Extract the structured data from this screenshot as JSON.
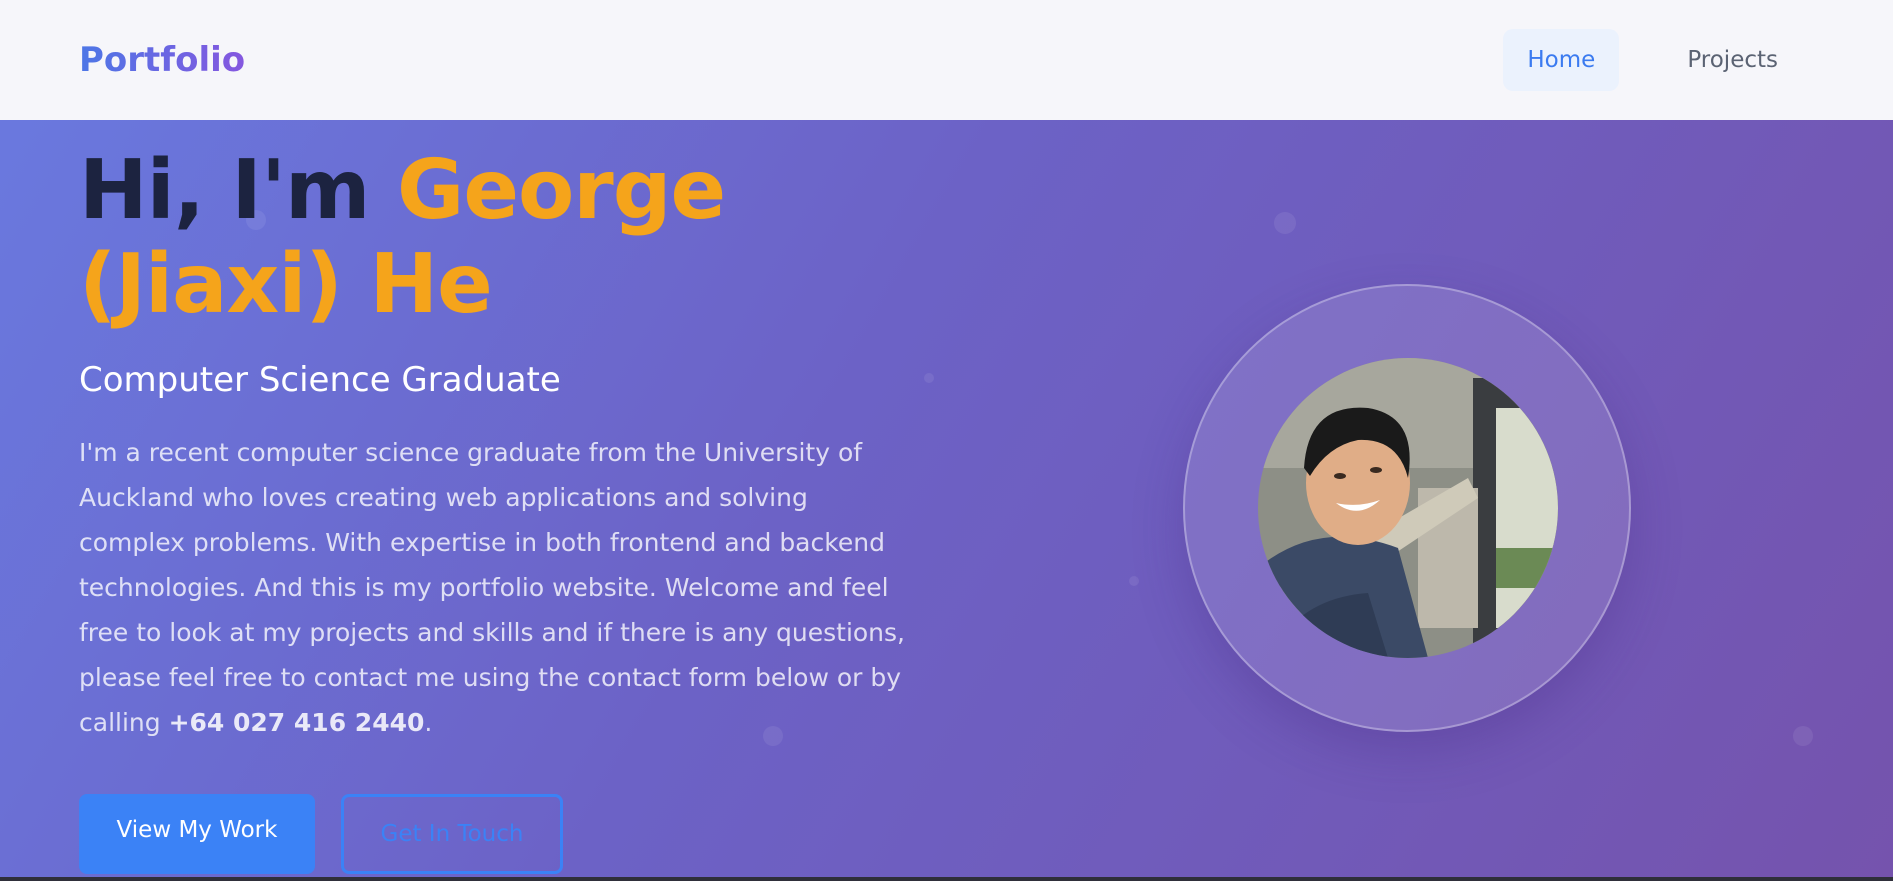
{
  "nav": {
    "logo": "Portfolio",
    "links": [
      {
        "label": "Home",
        "active": true
      },
      {
        "label": "Projects",
        "active": false
      }
    ]
  },
  "hero": {
    "greeting": "Hi, I'm ",
    "name_line1": "George",
    "name_line2": "(Jiaxi) He",
    "subtitle": "Computer Science Graduate",
    "bio": "I'm a recent computer science graduate from the University of Auckland who loves creating web applications and solving complex problems. With expertise in both frontend and backend technologies. And this is my portfolio website. Welcome and feel free to look at my projects and skills and if there is any questions, please feel free to contact me using the contact form below or by calling ",
    "phone": "+64 027 416 2440",
    "bio_end": ".",
    "buttons": {
      "primary": "View My Work",
      "secondary": "Get In Touch"
    }
  },
  "colors": {
    "accent": "#3b82f6",
    "name_highlight": "#f5a41b",
    "headline": "#1c2340"
  }
}
